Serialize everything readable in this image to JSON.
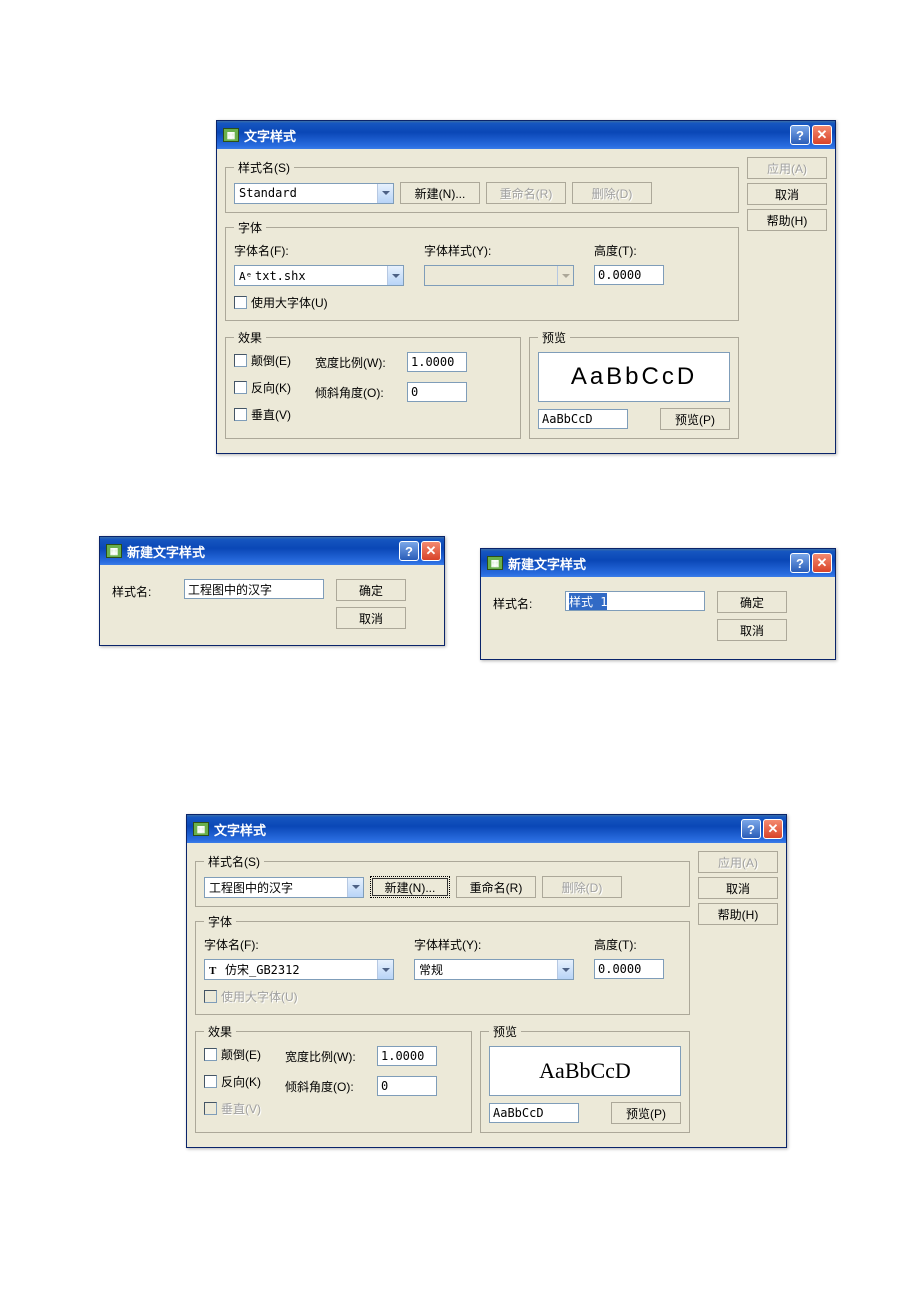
{
  "dialog1": {
    "title": "文字样式",
    "groups": {
      "styleName": "样式名(S)",
      "font": "字体",
      "effects": "效果",
      "preview": "预览"
    },
    "styleValue": "Standard",
    "btnNew": "新建(N)...",
    "btnRename": "重命名(R)",
    "btnDelete": "删除(D)",
    "btnApply": "应用(A)",
    "btnCancel": "取消",
    "btnHelp": "帮助(H)",
    "fontNameLabel": "字体名(F):",
    "fontStyleLabel": "字体样式(Y):",
    "heightLabel": "高度(T):",
    "fontNameValue": "txt.shx",
    "fontStyleValue": "",
    "heightValue": "0.0000",
    "useBigFont": "使用大字体(U)",
    "effUpside": "颠倒(E)",
    "effBackward": "反向(K)",
    "effVertical": "垂直(V)",
    "widthLabel": "宽度比例(W):",
    "widthValue": "1.0000",
    "obliqueLabel": "倾斜角度(O):",
    "obliqueValue": "0",
    "previewBig": "AaBbCcD",
    "previewSmall": "AaBbCcD",
    "btnPreview": "预览(P)"
  },
  "dialog2": {
    "title": "新建文字样式",
    "label": "样式名:",
    "value": "工程图中的汉字",
    "btnOk": "确定",
    "btnCancel": "取消"
  },
  "dialog3": {
    "title": "新建文字样式",
    "label": "样式名:",
    "value": "样式 1",
    "btnOk": "确定",
    "btnCancel": "取消"
  },
  "dialog4": {
    "title": "文字样式",
    "groups": {
      "styleName": "样式名(S)",
      "font": "字体",
      "effects": "效果",
      "preview": "预览"
    },
    "styleValue": "工程图中的汉字",
    "btnNew": "新建(N)...",
    "btnRename": "重命名(R)",
    "btnDelete": "删除(D)",
    "btnApply": "应用(A)",
    "btnCancel": "取消",
    "btnHelp": "帮助(H)",
    "fontNameLabel": "字体名(F):",
    "fontStyleLabel": "字体样式(Y):",
    "heightLabel": "高度(T):",
    "fontNameValue": "仿宋_GB2312",
    "fontStyleValue": "常规",
    "heightValue": "0.0000",
    "useBigFont": "使用大字体(U)",
    "effUpside": "颠倒(E)",
    "effBackward": "反向(K)",
    "effVertical": "垂直(V)",
    "widthLabel": "宽度比例(W):",
    "widthValue": "1.0000",
    "obliqueLabel": "倾斜角度(O):",
    "obliqueValue": "0",
    "previewBig": "AaBbCcD",
    "previewSmall": "AaBbCcD",
    "btnPreview": "预览(P)"
  }
}
